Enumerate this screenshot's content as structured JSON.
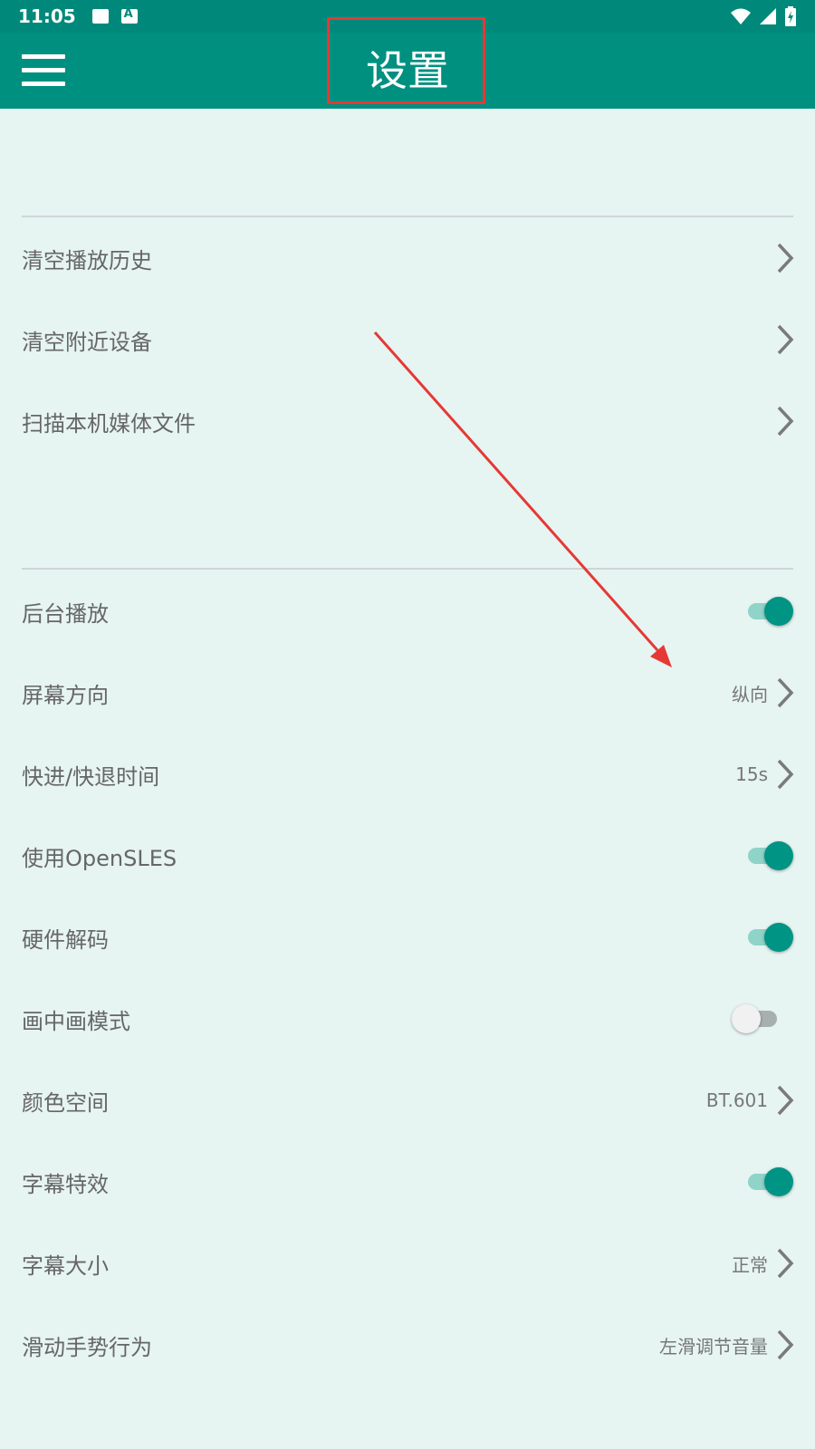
{
  "status": {
    "time": "11:05"
  },
  "app_bar": {
    "title": "设置"
  },
  "sections": [
    {
      "items": [
        {
          "label": "清空播放历史",
          "type": "nav"
        },
        {
          "label": "清空附近设备",
          "type": "nav"
        },
        {
          "label": "扫描本机媒体文件",
          "type": "nav"
        }
      ]
    },
    {
      "items": [
        {
          "label": "后台播放",
          "type": "toggle",
          "on": true
        },
        {
          "label": "屏幕方向",
          "type": "nav",
          "value": "纵向"
        },
        {
          "label": "快进/快退时间",
          "type": "nav",
          "value": "15s"
        },
        {
          "label": "使用OpenSLES",
          "type": "toggle",
          "on": true
        },
        {
          "label": "硬件解码",
          "type": "toggle",
          "on": true
        },
        {
          "label": "画中画模式",
          "type": "toggle",
          "on": false
        },
        {
          "label": "颜色空间",
          "type": "nav",
          "value": "BT.601"
        },
        {
          "label": "字幕特效",
          "type": "toggle",
          "on": true
        },
        {
          "label": "字幕大小",
          "type": "nav",
          "value": "正常"
        },
        {
          "label": "滑动手势行为",
          "type": "nav",
          "value": "左滑调节音量"
        }
      ]
    }
  ],
  "colors": {
    "primary": "#009080",
    "status_bar": "#00897b",
    "background": "#e6f4f2",
    "annotation": "#e53935"
  }
}
